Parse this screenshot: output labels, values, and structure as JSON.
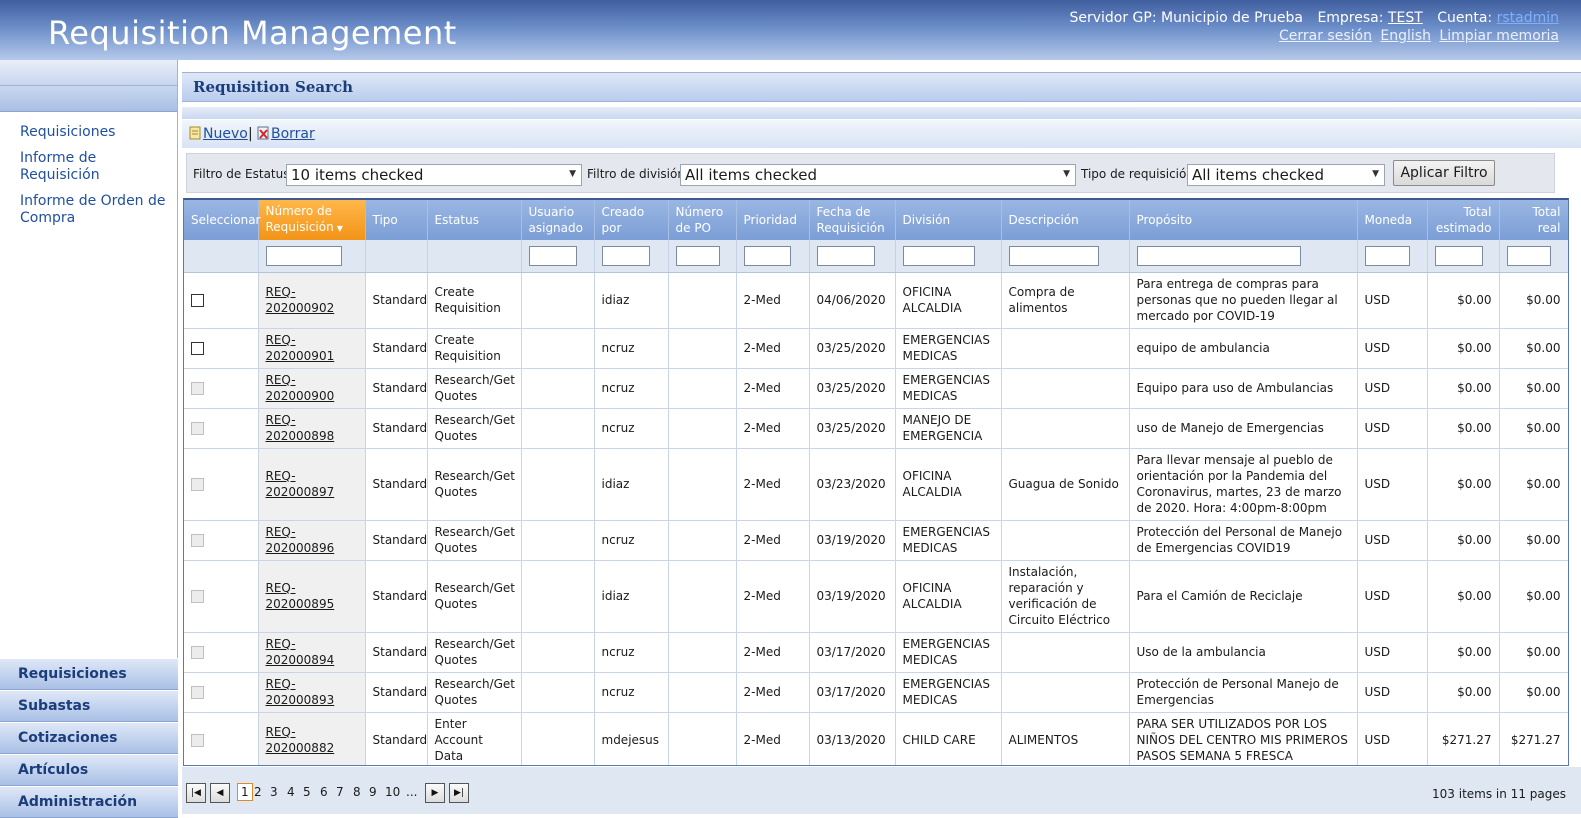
{
  "header": {
    "app_title": "Requisition Management",
    "server_label": "Servidor GP:",
    "server_value": "Municipio de Prueba",
    "company_label": "Empresa:",
    "company_value": "TEST",
    "account_label": "Cuenta:",
    "account_value": "rstadmin",
    "links": [
      "Cerrar sesión",
      "English",
      "Limpiar memoria"
    ]
  },
  "sidebar": {
    "links": [
      "Requisiciones",
      "Informe de Requisición",
      "Informe de Orden de Compra"
    ],
    "nav": [
      "Requisiciones",
      "Subastas",
      "Cotizaciones",
      "Artículos",
      "Administración"
    ]
  },
  "main": {
    "title": "Requisition Search",
    "toolbar": {
      "new_label": "Nuevo",
      "separator": "|",
      "delete_label": "Borrar"
    },
    "filters": {
      "status_label": "Filtro de Estatus",
      "status_value": "10 items checked",
      "division_label": "Filtro de división",
      "division_value": "All items checked",
      "type_label": "Tipo de requisición",
      "type_value": "All items checked",
      "apply_label": "Aplicar Filtro"
    },
    "grid": {
      "columns": [
        "Seleccionar",
        "Número de Requisición",
        "Tipo",
        "Estatus",
        "Usuario asignado",
        "Creado por",
        "Número de PO",
        "Prioridad",
        "Fecha de Requisición",
        "División",
        "Descripción",
        "Propósito",
        "Moneda",
        "Total estimado",
        "Total real"
      ],
      "rows": [
        {
          "checked": false,
          "enabled": true,
          "num": "REQ-202000902",
          "tipo": "Standard",
          "estatus": "Create Requisition",
          "usuario": "",
          "creado": "idiaz",
          "po": "",
          "prioridad": "2-Med",
          "fecha": "04/06/2020",
          "division": "OFICINA ALCALDIA",
          "descripcion": "Compra de alimentos",
          "proposito": "Para entrega de compras para personas que no pueden llegar al mercado por COVID-19",
          "moneda": "USD",
          "estimado": "$0.00",
          "real": "$0.00"
        },
        {
          "checked": false,
          "enabled": true,
          "num": "REQ-202000901",
          "tipo": "Standard",
          "estatus": "Create Requisition",
          "usuario": "",
          "creado": "ncruz",
          "po": "",
          "prioridad": "2-Med",
          "fecha": "03/25/2020",
          "division": "EMERGENCIAS MEDICAS",
          "descripcion": "",
          "proposito": "equipo de ambulancia",
          "moneda": "USD",
          "estimado": "$0.00",
          "real": "$0.00"
        },
        {
          "checked": false,
          "enabled": false,
          "num": "REQ-202000900",
          "tipo": "Standard",
          "estatus": "Research/Get Quotes",
          "usuario": "",
          "creado": "ncruz",
          "po": "",
          "prioridad": "2-Med",
          "fecha": "03/25/2020",
          "division": "EMERGENCIAS MEDICAS",
          "descripcion": "",
          "proposito": "Equipo para uso de Ambulancias",
          "moneda": "USD",
          "estimado": "$0.00",
          "real": "$0.00"
        },
        {
          "checked": false,
          "enabled": false,
          "num": "REQ-202000898",
          "tipo": "Standard",
          "estatus": "Research/Get Quotes",
          "usuario": "",
          "creado": "ncruz",
          "po": "",
          "prioridad": "2-Med",
          "fecha": "03/25/2020",
          "division": "MANEJO DE EMERGENCIA",
          "descripcion": "",
          "proposito": "uso de Manejo de Emergencias",
          "moneda": "USD",
          "estimado": "$0.00",
          "real": "$0.00"
        },
        {
          "checked": false,
          "enabled": false,
          "num": "REQ-202000897",
          "tipo": "Standard",
          "estatus": "Research/Get Quotes",
          "usuario": "",
          "creado": "idiaz",
          "po": "",
          "prioridad": "2-Med",
          "fecha": "03/23/2020",
          "division": "OFICINA ALCALDIA",
          "descripcion": "Guagua de Sonido",
          "proposito": "Para llevar mensaje al pueblo de orientación por la Pandemia del Coronavirus, martes, 23 de marzo de 2020. Hora: 4:00pm-8:00pm",
          "moneda": "USD",
          "estimado": "$0.00",
          "real": "$0.00"
        },
        {
          "checked": false,
          "enabled": false,
          "num": "REQ-202000896",
          "tipo": "Standard",
          "estatus": "Research/Get Quotes",
          "usuario": "",
          "creado": "ncruz",
          "po": "",
          "prioridad": "2-Med",
          "fecha": "03/19/2020",
          "division": "EMERGENCIAS MEDICAS",
          "descripcion": "",
          "proposito": "Protección del Personal de Manejo de Emergencias COVID19",
          "moneda": "USD",
          "estimado": "$0.00",
          "real": "$0.00"
        },
        {
          "checked": false,
          "enabled": false,
          "num": "REQ-202000895",
          "tipo": "Standard",
          "estatus": "Research/Get Quotes",
          "usuario": "",
          "creado": "idiaz",
          "po": "",
          "prioridad": "2-Med",
          "fecha": "03/19/2020",
          "division": "OFICINA ALCALDIA",
          "descripcion": "Instalación, reparación y verificación de Circuito Eléctrico",
          "proposito": "Para el Camión de Reciclaje",
          "moneda": "USD",
          "estimado": "$0.00",
          "real": "$0.00"
        },
        {
          "checked": false,
          "enabled": false,
          "num": "REQ-202000894",
          "tipo": "Standard",
          "estatus": "Research/Get Quotes",
          "usuario": "",
          "creado": "ncruz",
          "po": "",
          "prioridad": "2-Med",
          "fecha": "03/17/2020",
          "division": "EMERGENCIAS MEDICAS",
          "descripcion": "",
          "proposito": "Uso de la ambulancia",
          "moneda": "USD",
          "estimado": "$0.00",
          "real": "$0.00"
        },
        {
          "checked": false,
          "enabled": false,
          "num": "REQ-202000893",
          "tipo": "Standard",
          "estatus": "Research/Get Quotes",
          "usuario": "",
          "creado": "ncruz",
          "po": "",
          "prioridad": "2-Med",
          "fecha": "03/17/2020",
          "division": "EMERGENCIAS MEDICAS",
          "descripcion": "",
          "proposito": "Protección de Personal Manejo de Emergencias",
          "moneda": "USD",
          "estimado": "$0.00",
          "real": "$0.00"
        },
        {
          "checked": false,
          "enabled": false,
          "num": "REQ-202000882",
          "tipo": "Standard",
          "estatus": "Enter Account Data",
          "usuario": "",
          "creado": "mdejesus",
          "po": "",
          "prioridad": "2-Med",
          "fecha": "03/13/2020",
          "division": "CHILD CARE",
          "descripcion": "ALIMENTOS",
          "proposito": "PARA SER UTILIZADOS POR LOS NIÑOS DEL CENTRO MIS PRIMEROS PASOS SEMANA 5 FRESCA",
          "moneda": "USD",
          "estimado": "$271.27",
          "real": "$271.27"
        }
      ]
    },
    "pager": {
      "pages": [
        "1",
        "2",
        "3",
        "4",
        "5",
        "6",
        "7",
        "8",
        "9",
        "10",
        "..."
      ],
      "current_page": "1",
      "info": "103 items in 11 pages"
    }
  }
}
